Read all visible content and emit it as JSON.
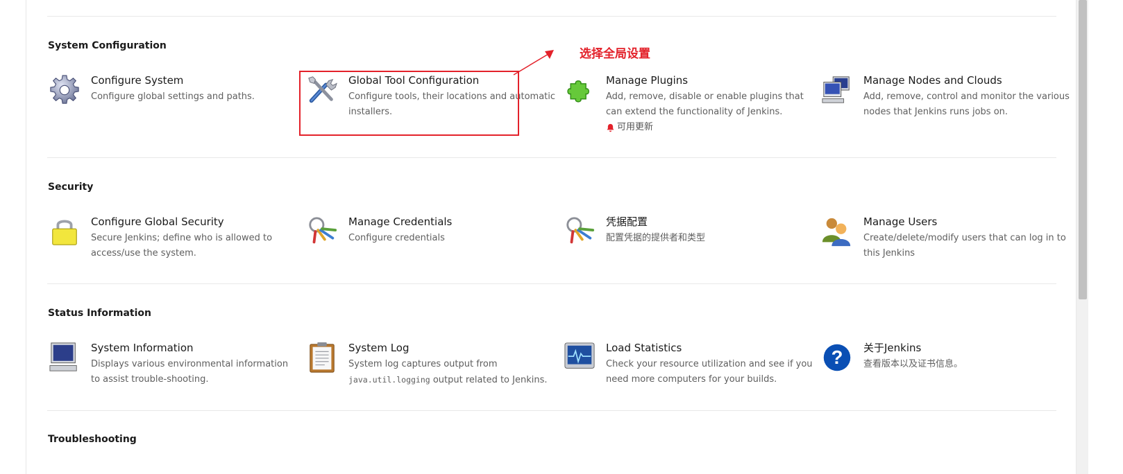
{
  "annotation": {
    "label": "选择全局设置",
    "color": "#e3212a"
  },
  "sections": {
    "system": {
      "title": "System Configuration",
      "items": [
        {
          "title": "Configure System",
          "desc": "Configure global settings and paths.",
          "icon": "gear-icon"
        },
        {
          "title": "Global Tool Configuration",
          "desc": "Configure tools, their locations and automatic installers.",
          "icon": "tools-icon"
        },
        {
          "title": "Manage Plugins",
          "desc": "Add, remove, disable or enable plugins that can extend the functionality of Jenkins.",
          "badge": "可用更新",
          "icon": "puzzle-icon"
        },
        {
          "title": "Manage Nodes and Clouds",
          "desc": "Add, remove, control and monitor the various nodes that Jenkins runs jobs on.",
          "icon": "computers-icon"
        }
      ]
    },
    "security": {
      "title": "Security",
      "items": [
        {
          "title": "Configure Global Security",
          "desc": "Secure Jenkins; define who is allowed to access/use the system.",
          "icon": "lock-icon"
        },
        {
          "title": "Manage Credentials",
          "desc": "Configure credentials",
          "icon": "keys-icon"
        },
        {
          "title": "凭据配置",
          "desc": "配置凭据的提供者和类型",
          "icon": "keys-icon"
        },
        {
          "title": "Manage Users",
          "desc": "Create/delete/modify users that can log in to this Jenkins",
          "icon": "users-icon"
        }
      ]
    },
    "status": {
      "title": "Status Information",
      "items": [
        {
          "title": "System Information",
          "desc": "Displays various environmental information to assist trouble-shooting.",
          "icon": "monitor-icon"
        },
        {
          "title": "System Log",
          "desc_code": "java.util.logging",
          "desc_pre": "System log captures output from ",
          "desc_post": " output related to Jenkins.",
          "icon": "clipboard-icon"
        },
        {
          "title": "Load Statistics",
          "desc": "Check your resource utilization and see if you need more computers for your builds.",
          "icon": "load-monitor-icon"
        },
        {
          "title": "关于Jenkins",
          "desc": "查看版本以及证书信息。",
          "icon": "help-icon"
        }
      ]
    },
    "troubleshooting": {
      "title": "Troubleshooting"
    }
  }
}
